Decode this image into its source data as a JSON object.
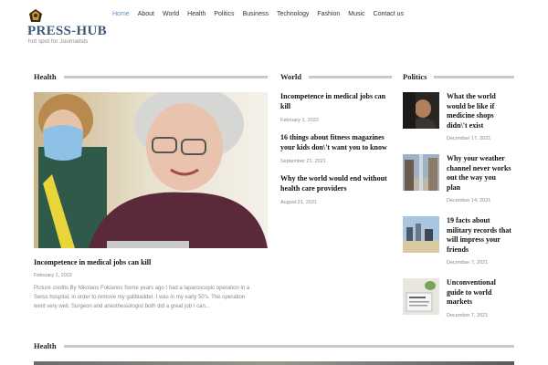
{
  "site": {
    "name": "PRESS-HUB",
    "tagline": "hot spot for Journalists"
  },
  "nav": [
    "Home",
    "About",
    "World",
    "Health",
    "Politics",
    "Business",
    "Technology",
    "Fashion",
    "Music",
    "Contact us"
  ],
  "health": {
    "heading": "Health",
    "feature": {
      "title": "Incompetence in medical jobs can kill",
      "date": "February 1, 2022",
      "excerpt_lines": [
        "Picture credits By Nikolaos Fokianos Some years ago I had a laparoscopic operation in a",
        "Swiss hospital, in order to remove my gallbladder. I was in my early 50's. The operation",
        "went very well. Surgeon and anesthesiologist both did a great job I can..."
      ]
    }
  },
  "world": {
    "heading": "World",
    "items": [
      {
        "title_lines": [
          "Incompetence in medical jobs can",
          "kill"
        ],
        "date": "February 1, 2022"
      },
      {
        "title_lines": [
          "16 things about fitness magazines",
          "your kids don\\'t want you to know"
        ],
        "date": "September 21, 2021"
      },
      {
        "title_lines": [
          "Why the world would end without",
          "health care providers"
        ],
        "date": "August 21, 2021"
      }
    ]
  },
  "politics": {
    "heading": "Politics",
    "items": [
      {
        "title_lines": [
          "What the world",
          "would be like if",
          "medicine shops",
          "didn\\'t exist"
        ],
        "date": "December 17, 2021"
      },
      {
        "title_lines": [
          "Why your weather",
          "channel never works",
          "out the way you",
          "plan"
        ],
        "date": "December 14, 2021"
      },
      {
        "title_lines": [
          "19 facts about",
          "military records that",
          "will impress your",
          "friends"
        ],
        "date": "December 7, 2021"
      },
      {
        "title_lines": [
          "Unconventional",
          "guide to world",
          "markets"
        ],
        "date": "December 7, 2021"
      }
    ]
  },
  "health2": {
    "heading": "Health"
  },
  "colors": {
    "brand": "#3d5a78",
    "nav_active": "#5b8fbf",
    "divider": "#c9c9c9"
  }
}
